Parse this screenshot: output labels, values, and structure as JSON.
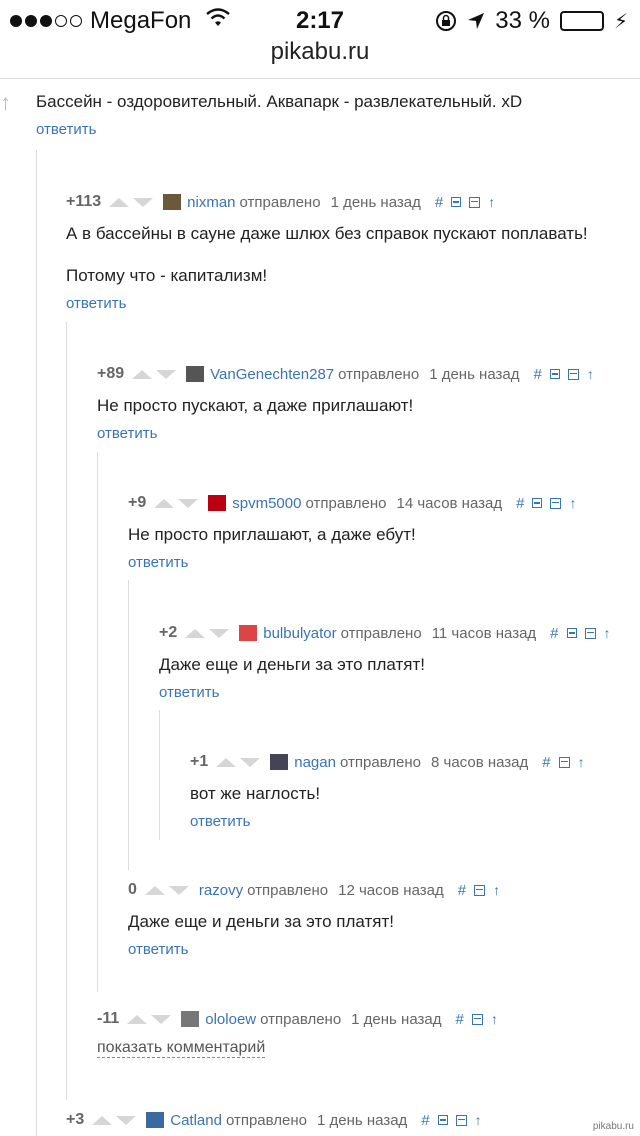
{
  "status": {
    "carrier": "MegaFon",
    "time": "2:17",
    "battery": "33 %",
    "battery_level": 0.33
  },
  "url": "pikabu.ru",
  "top_comment": {
    "text": "Бассейн - оздоровительный. Аквапарк - развлекательный. xD",
    "reply": "ответить"
  },
  "comments": [
    {
      "score": "+113",
      "user": "nixman",
      "sent": "отправлено",
      "time": "1 день назад",
      "lines": [
        "А в бассейны в сауне даже шлюх без справок пускают поплавать!",
        "Потому что - капитализм!"
      ],
      "reply": "ответить"
    },
    {
      "score": "+89",
      "user": "VanGenechten287",
      "sent": "отправлено",
      "time": "1 день назад",
      "lines": [
        "Не просто пускают, а даже приглашают!"
      ],
      "reply": "ответить"
    },
    {
      "score": "+9",
      "user": "spvm5000",
      "sent": "отправлено",
      "time": "14 часов назад",
      "lines": [
        "Не просто приглашают, а даже ебут!"
      ],
      "reply": "ответить"
    },
    {
      "score": "+2",
      "user": "bulbulyator",
      "sent": "отправлено",
      "time": "11 часов назад",
      "lines": [
        "Даже еще и деньги за это платят!"
      ],
      "reply": "ответить"
    },
    {
      "score": "+1",
      "user": "nagan",
      "sent": "отправлено",
      "time": "8 часов назад",
      "lines": [
        "вот же наглость!"
      ],
      "reply": "ответить"
    },
    {
      "score": "0",
      "user": "razovy",
      "sent": "отправлено",
      "time": "12 часов назад",
      "lines": [
        "Даже еще и деньги за это платят!"
      ],
      "reply": "ответить"
    },
    {
      "score": "-11",
      "user": "ololoew",
      "sent": "отправлено",
      "time": "1 день назад",
      "show": "показать комментарий"
    },
    {
      "score": "+3",
      "user": "Catland",
      "sent": "отправлено",
      "time": "1 день назад"
    }
  ],
  "icons": {
    "hash": "#",
    "up": "↑"
  },
  "watermark": "pikabu.ru",
  "colors": {
    "link": "#3a74b7",
    "battery": "#4cd964"
  }
}
